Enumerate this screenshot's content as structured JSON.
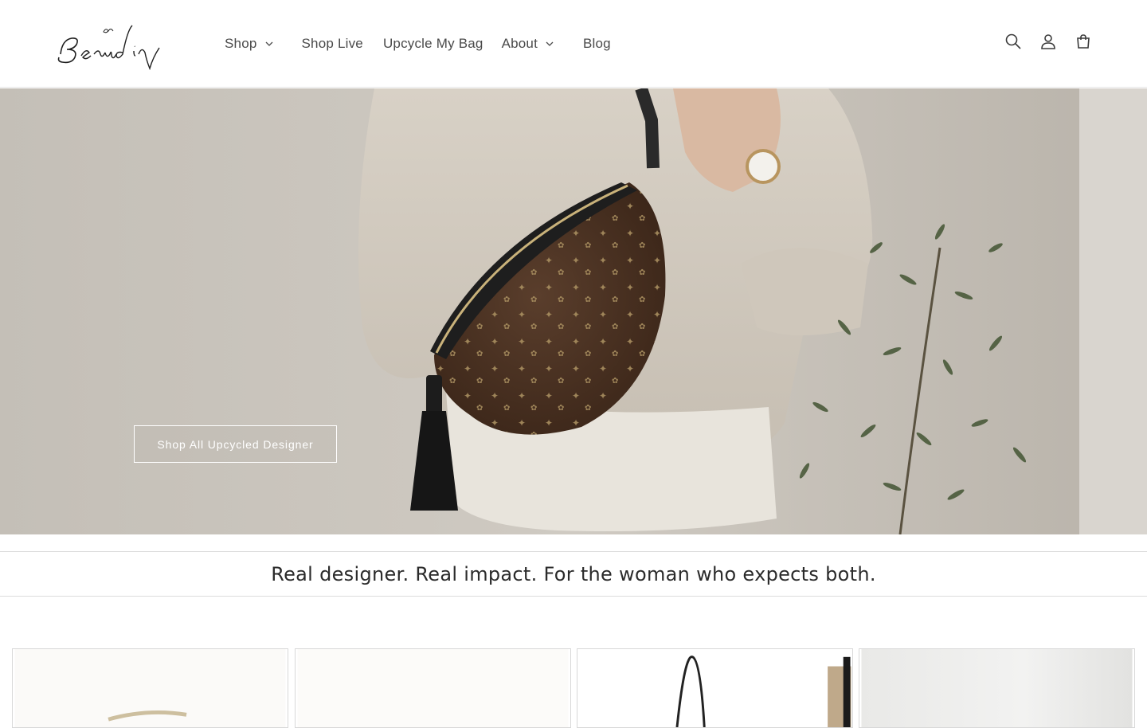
{
  "brand": {
    "logo_text": "Beaudin"
  },
  "nav": {
    "items": [
      {
        "label": "Shop",
        "has_dropdown": true
      },
      {
        "label": "Shop Live",
        "has_dropdown": false
      },
      {
        "label": "Upcycle My Bag",
        "has_dropdown": false
      },
      {
        "label": "About",
        "has_dropdown": true
      },
      {
        "label": "Blog",
        "has_dropdown": false
      }
    ]
  },
  "header_icons": [
    "search-icon",
    "account-icon",
    "cart-icon"
  ],
  "hero": {
    "cta_label": "Shop All Upcycled Designer"
  },
  "tagline": "Real designer. Real impact. For the woman who expects both.",
  "colors": {
    "text": "#3a3a3a",
    "border": "#dcdcdc",
    "hero_bg": "#c9c4bc"
  },
  "product_cards": [
    {
      "name": "product-card-1"
    },
    {
      "name": "product-card-2"
    },
    {
      "name": "product-card-3"
    },
    {
      "name": "product-card-4"
    }
  ]
}
